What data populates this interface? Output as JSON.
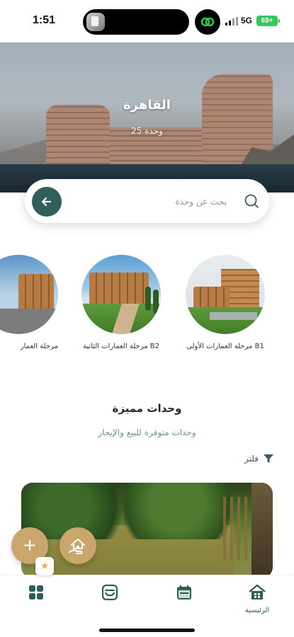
{
  "status_bar": {
    "time": "1:51",
    "network": "5G",
    "battery": "69+"
  },
  "hero": {
    "city": "القاهرة",
    "units_count": "25 وحدة"
  },
  "search": {
    "placeholder": "بحث عن وحدة"
  },
  "phases": [
    {
      "label": "مرحلة العمارات الأولى B1"
    },
    {
      "label": "مرحلة العمارات الثانية B2"
    },
    {
      "label": "مرحلة العمار"
    }
  ],
  "featured": {
    "title": "وحدات مميزة",
    "subtitle": "وحدات متوفرة للبيع والإيجار",
    "filter_label": "فلتر"
  },
  "fab": {
    "add_symbol": "+",
    "star_symbol": "★"
  },
  "nav": {
    "home_label": "الرئيسية"
  },
  "colors": {
    "primary": "#2f5f5a",
    "accent": "#c8a66c",
    "muted": "#6f8f96"
  },
  "icons": [
    "search-icon",
    "arrow-left-icon",
    "filter-icon",
    "home-icon",
    "calendar-icon",
    "inbox-icon",
    "grid-icon",
    "house-hand-icon",
    "star-icon"
  ]
}
